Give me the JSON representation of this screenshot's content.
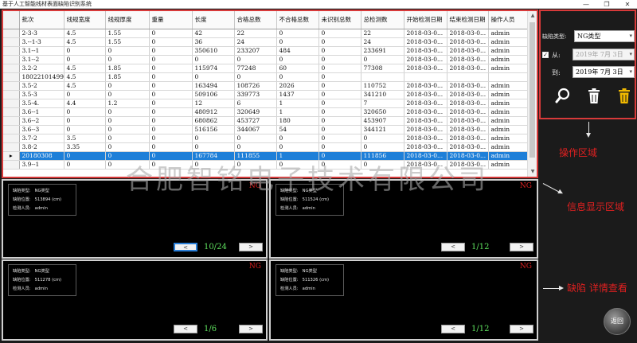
{
  "window": {
    "title": "基于人工智能线材表面缺陷识别系统",
    "min": "—",
    "max": "❐",
    "close": "✕"
  },
  "table": {
    "columns": [
      "批次",
      "线规宽度",
      "线规厚度",
      "重量",
      "长度",
      "合格总数",
      "不合格总数",
      "未识别总数",
      "总检测数",
      "开始检测日期",
      "结束检测日期",
      "操作人员"
    ],
    "selected_index": 14,
    "row_marker": "▸",
    "rows": [
      [
        "2-3-3",
        "4.5",
        "1.55",
        "0",
        "42",
        "22",
        "0",
        "0",
        "22",
        "2018-03-0...",
        "2018-03-0...",
        "admin"
      ],
      [
        "3.--1-3",
        "4.5",
        "1.55",
        "0",
        "36",
        "24",
        "0",
        "0",
        "24",
        "2018-03-0...",
        "2018-03-0...",
        "admin"
      ],
      [
        "3.1--1",
        "0",
        "0",
        "0",
        "350610",
        "233207",
        "484",
        "0",
        "233691",
        "2018-03-0...",
        "2018-03-0...",
        "admin"
      ],
      [
        "3.1--2",
        "0",
        "0",
        "0",
        "0",
        "0",
        "0",
        "0",
        "0",
        "2018-03-0...",
        "2018-03-0...",
        "admin"
      ],
      [
        "3.2-2",
        "4.5",
        "1.85",
        "0",
        "115974",
        "77248",
        "60",
        "0",
        "77308",
        "2018-03-0...",
        "2018-03-0...",
        "admin"
      ],
      [
        "18022101499",
        "4.5",
        "1.85",
        "0",
        "0",
        "0",
        "0",
        "0",
        "",
        "",
        "",
        ""
      ],
      [
        "3.5-2",
        "4.5",
        "0",
        "0",
        "163494",
        "108726",
        "2026",
        "0",
        "110752",
        "2018-03-0...",
        "2018-03-0...",
        "admin"
      ],
      [
        "3.5-3",
        "0",
        "0",
        "0",
        "509106",
        "339773",
        "1437",
        "0",
        "341210",
        "2018-03-0...",
        "2018-03-0...",
        "admin"
      ],
      [
        "3.5-4.",
        "4.4",
        "1.2",
        "0",
        "12",
        "6",
        "1",
        "0",
        "7",
        "2018-03-0...",
        "2018-03-0...",
        "admin"
      ],
      [
        "3.6--1",
        "0",
        "0",
        "0",
        "480912",
        "320649",
        "1",
        "0",
        "320650",
        "2018-03-0...",
        "2018-03-0...",
        "admin"
      ],
      [
        "3.6--2",
        "0",
        "0",
        "0",
        "680862",
        "453727",
        "180",
        "0",
        "453907",
        "2018-03-0...",
        "2018-03-0...",
        "admin"
      ],
      [
        "3.6--3",
        "0",
        "0",
        "0",
        "516156",
        "344067",
        "54",
        "0",
        "344121",
        "2018-03-0...",
        "2018-03-0...",
        "admin"
      ],
      [
        "3.7-2",
        "3.5",
        "0",
        "0",
        "0",
        "0",
        "0",
        "0",
        "0",
        "2018-03-0...",
        "2018-03-0...",
        "admin"
      ],
      [
        "3.8-2",
        "3.35",
        "0",
        "0",
        "0",
        "0",
        "0",
        "0",
        "0",
        "2018-03-0...",
        "2018-03-0...",
        "admin"
      ],
      [
        "20180308",
        "0",
        "0",
        "0",
        "167784",
        "111855",
        "1",
        "0",
        "111856",
        "2018-03-0...",
        "2018-03-0...",
        "admin"
      ],
      [
        "3.9--1",
        "0",
        "0",
        "0",
        "0",
        "0",
        "0",
        "0",
        "0",
        "2018-03-0...",
        "2018-03-0...",
        "admin"
      ]
    ]
  },
  "watermark": "合肥智铭电子技术有限公司",
  "panels": [
    {
      "ng": "NG",
      "type_label": "缺陷类型:",
      "type_value": "NG类型",
      "pos_label": "缺陷位置:",
      "pos_value": "513894 (cm)",
      "op_label": "检测人员:",
      "op_value": "admin",
      "counter": "10/24",
      "prev": "<",
      "next": ">"
    },
    {
      "ng": "NG",
      "type_label": "缺陷类型:",
      "type_value": "NG类型",
      "pos_label": "缺陷位置:",
      "pos_value": "511524 (cm)",
      "op_label": "检测人员:",
      "op_value": "admin",
      "counter": "1/12",
      "prev": "<",
      "next": ">"
    },
    {
      "ng": "NG",
      "type_label": "缺陷类型:",
      "type_value": "NG类型",
      "pos_label": "缺陷位置:",
      "pos_value": "511278 (cm)",
      "op_label": "检测人员:",
      "op_value": "admin",
      "counter": "1/6",
      "prev": "<",
      "next": ">"
    },
    {
      "ng": "NG",
      "type_label": "缺陷类型:",
      "type_value": "NG类型",
      "pos_label": "缺陷位置:",
      "pos_value": "511326 (cm)",
      "op_label": "检测人员:",
      "op_value": "admin",
      "counter": "1/12",
      "prev": "<",
      "next": ">"
    }
  ],
  "controls": {
    "defect_type_label": "缺陷类型:",
    "defect_type_value": "NG类型",
    "from_checked": true,
    "check_mark": "✓",
    "from_label": "从:",
    "from_date": "2019年 7月 3日",
    "to_label": "到:",
    "to_date": "2019年 7月 3日",
    "dropdown_glyph": "▾"
  },
  "annotations": {
    "operation_area": "操作区域",
    "info_area": "信息显示区域",
    "detail_view": "缺陷 详情查看"
  },
  "return_button": "返回",
  "colors": {
    "frame_red": "#d83a3a",
    "selection_blue": "#1e7fd8",
    "counter_green": "#5ee05e",
    "ng_red": "#e02020",
    "search_icon": "#ffffff",
    "delete_icon": "#ffffff",
    "clear_icon": "#f0b800"
  }
}
